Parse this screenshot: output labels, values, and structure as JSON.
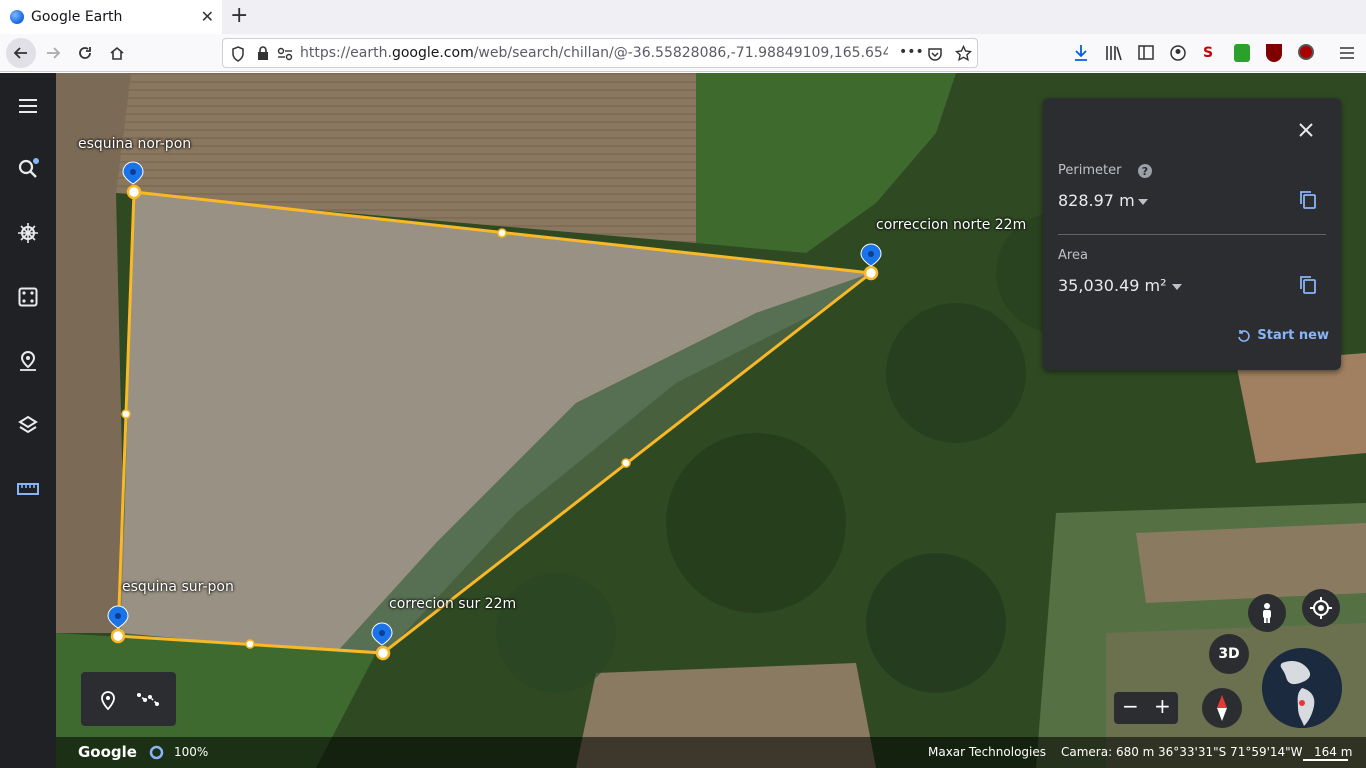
{
  "browser": {
    "tab_title": "Google Earth",
    "new_tab": "+",
    "close_tab": "✕",
    "url_prefix": "https://earth.",
    "url_domain": "google.com",
    "url_rest": "/web/search/chillan/@-36.55828086,-71.98849109,165.654",
    "url_more": "•••"
  },
  "measure_panel": {
    "perimeter_label": "Perimeter",
    "perimeter_value": "828.97 m",
    "area_label": "Area",
    "area_value": "35,030.49 m²",
    "start_new": "Start new"
  },
  "pins": [
    {
      "label": "esquina nor-pon"
    },
    {
      "label": "correccion norte 22m"
    },
    {
      "label": "esquina sur-pon"
    },
    {
      "label": "correcion sur 22m"
    }
  ],
  "controls": {
    "three_d": "3D",
    "zoom_out": "−",
    "zoom_in": "+"
  },
  "status_bar": {
    "brand": "Google",
    "load_progress": "100%",
    "imagery_credit": "Maxar Technologies",
    "camera": "Camera: 680 m",
    "coordinates": "36°33'31\"S 71°59'14\"W",
    "scale": "164 m"
  },
  "colors": {
    "polygon_stroke": "#f9b825",
    "pin_blue": "#1a73e8",
    "accent_link": "#8ab4f8"
  }
}
